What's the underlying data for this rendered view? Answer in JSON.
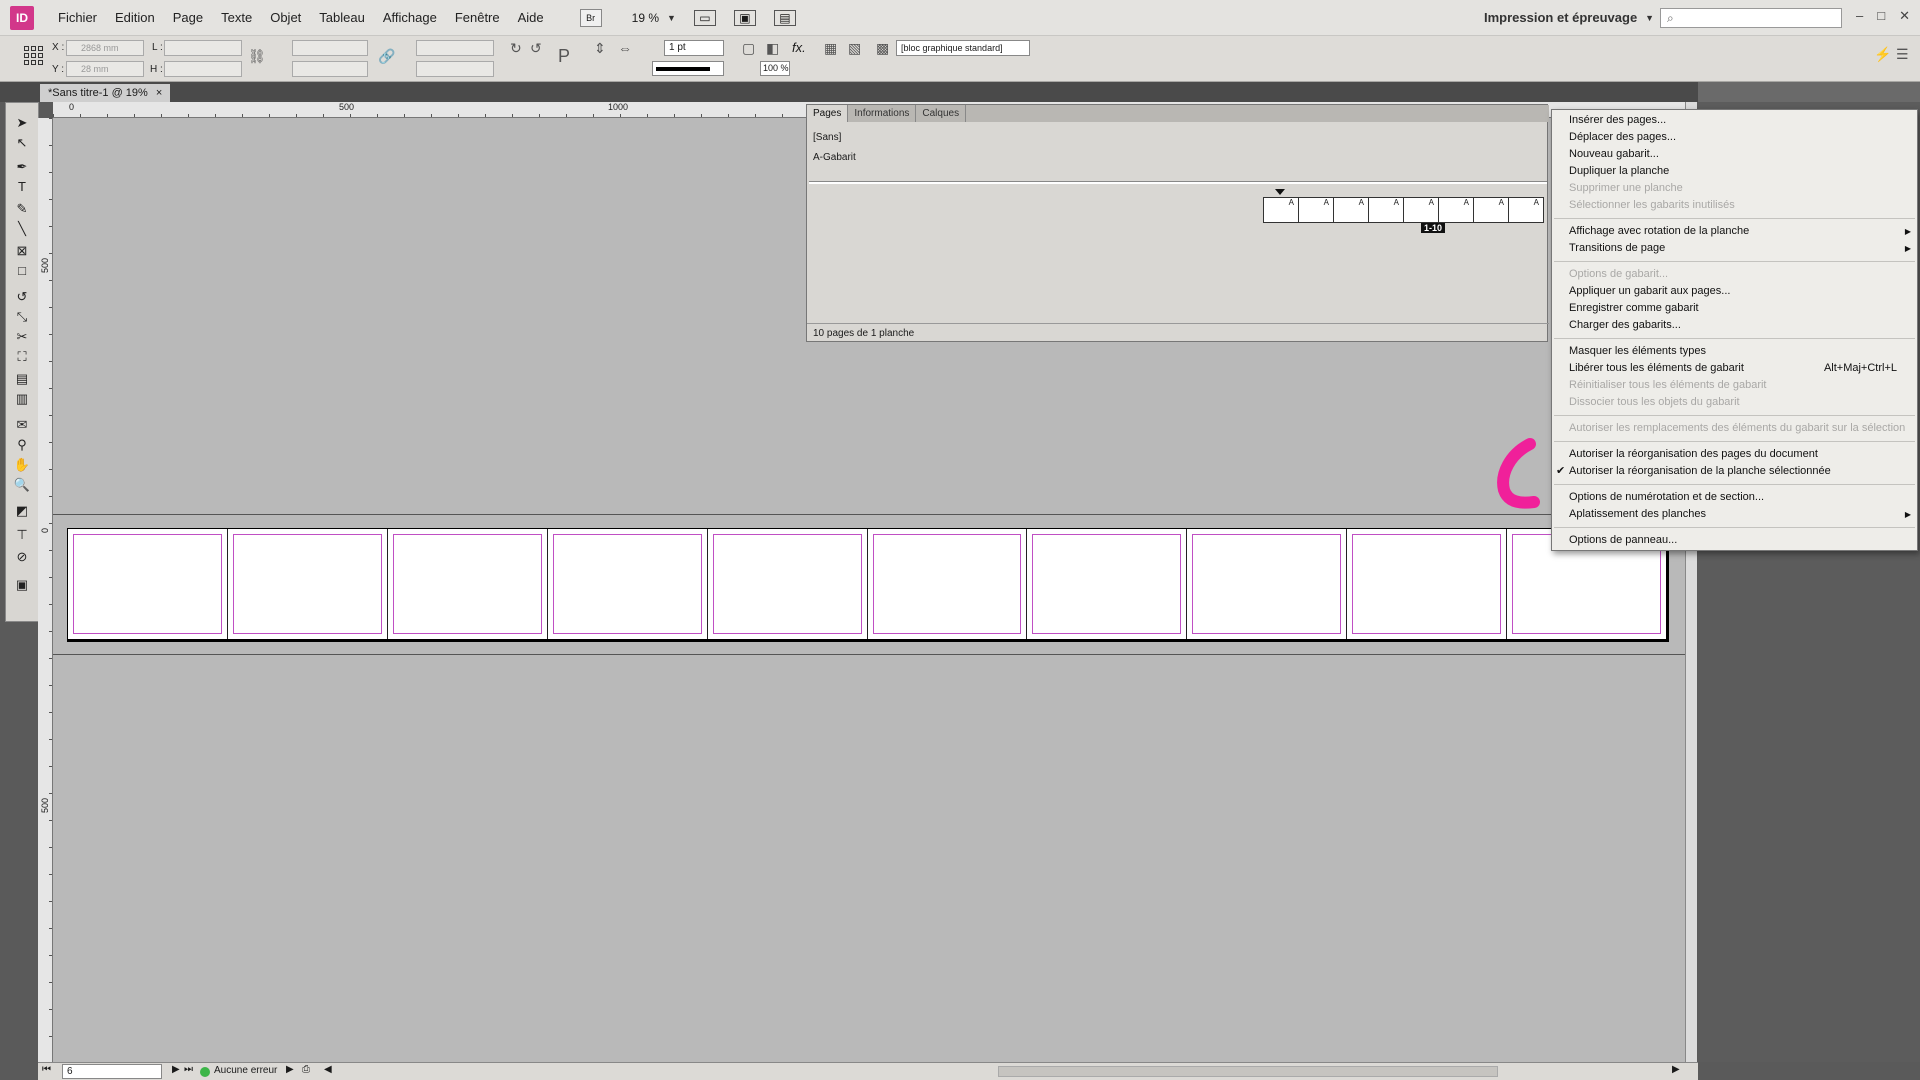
{
  "app": {
    "icon_label": "ID"
  },
  "menubar": {
    "items": [
      "Fichier",
      "Edition",
      "Page",
      "Texte",
      "Objet",
      "Tableau",
      "Affichage",
      "Fenêtre",
      "Aide"
    ],
    "bridge_label": "Br",
    "zoom": "19 %",
    "workspace": "Impression et épreuvage",
    "search_placeholder": ""
  },
  "controlbar": {
    "x_label": "X :",
    "y_label": "Y :",
    "w_label": "L :",
    "h_label": "H :",
    "x_value": "2868 mm",
    "y_value": "28 mm",
    "stroke_weight": "1 pt",
    "opacity": "100 %",
    "fx_label": "fx.",
    "object_style": "[bloc graphique standard]"
  },
  "document_tab": {
    "title": "*Sans titre-1 @ 19%",
    "close": "×"
  },
  "ruler": {
    "h_ticks": [
      "0",
      "500",
      "1000"
    ],
    "v_ticks": [
      "500",
      "0",
      "500"
    ]
  },
  "pages_panel": {
    "tabs": [
      "Pages",
      "Informations",
      "Calques"
    ],
    "none_master": "[Sans]",
    "a_master": "A-Gabarit",
    "thumb_label": "A",
    "range_label": "1-10",
    "status": "10 pages de 1 planche"
  },
  "spread": {
    "page_count": 10
  },
  "context_menu": {
    "groups": [
      [
        {
          "label": "Insérer des pages...",
          "disabled": false
        },
        {
          "label": "Déplacer des pages...",
          "disabled": false
        },
        {
          "label": "Nouveau gabarit...",
          "disabled": false
        },
        {
          "label": "Dupliquer la planche",
          "disabled": false
        },
        {
          "label": "Supprimer une planche",
          "disabled": true
        },
        {
          "label": "Sélectionner les gabarits inutilisés",
          "disabled": true
        }
      ],
      [
        {
          "label": "Affichage avec rotation de la planche",
          "disabled": false,
          "submenu": true
        },
        {
          "label": "Transitions de page",
          "disabled": false,
          "submenu": true
        }
      ],
      [
        {
          "label": "Options de gabarit...",
          "disabled": true
        },
        {
          "label": "Appliquer un gabarit aux pages...",
          "disabled": false
        },
        {
          "label": "Enregistrer comme gabarit",
          "disabled": false
        },
        {
          "label": "Charger des gabarits...",
          "disabled": false
        }
      ],
      [
        {
          "label": "Masquer les éléments types",
          "disabled": false
        },
        {
          "label": "Libérer tous les éléments de gabarit",
          "disabled": false,
          "shortcut": "Alt+Maj+Ctrl+L"
        },
        {
          "label": "Réinitialiser tous les éléments de gabarit",
          "disabled": true
        },
        {
          "label": "Dissocier tous les objets du gabarit",
          "disabled": true
        }
      ],
      [
        {
          "label": "Autoriser les remplacements des éléments du gabarit sur la sélection",
          "disabled": true
        }
      ],
      [
        {
          "label": "Autoriser la réorganisation des pages du document",
          "disabled": false
        },
        {
          "label": "Autoriser la réorganisation de la planche sélectionnée",
          "disabled": false,
          "checked": true
        }
      ],
      [
        {
          "label": "Options de numérotation et de section...",
          "disabled": false
        },
        {
          "label": "Aplatissement des planches",
          "disabled": false,
          "submenu": true
        }
      ],
      [
        {
          "label": "Options de panneau...",
          "disabled": false
        }
      ]
    ]
  },
  "statusbar": {
    "page_number": "6",
    "preflight": "Aucune erreur"
  },
  "colors": {
    "scribble": "#f0209a",
    "margin_guide": "#c04fc4",
    "preflight_ok": "#3cb548",
    "app_icon": "#d2378a"
  }
}
